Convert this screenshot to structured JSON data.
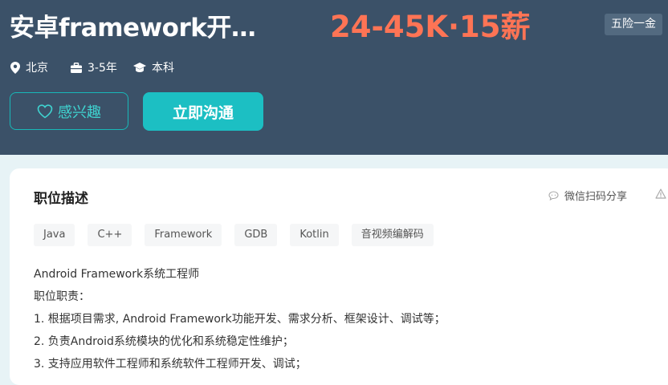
{
  "job": {
    "title": "安卓framework开…",
    "salary": "24-45K·15薪",
    "benefit_badge": "五险一金",
    "city": "北京",
    "experience": "3-5年",
    "education": "本科"
  },
  "actions": {
    "interest_label": "感兴趣",
    "chat_label": "立即沟通"
  },
  "description": {
    "section_title": "职位描述",
    "share_label": "微信扫码分享",
    "tags": [
      "Java",
      "C++",
      "Framework",
      "GDB",
      "Kotlin",
      "音视频编解码"
    ],
    "lines": [
      "Android Framework系统工程师",
      "职位职责：",
      "1. 根据项目需求, Android Framework功能开发、需求分析、框架设计、调试等；",
      "2. 负责Android系统模块的优化和系统稳定性维护；",
      "3. 支持应用软件工程师和系统软件工程师开发、调试；"
    ]
  },
  "colors": {
    "header_bg": "#3b5168",
    "salary": "#fe7455",
    "accent": "#1cbfc3"
  }
}
